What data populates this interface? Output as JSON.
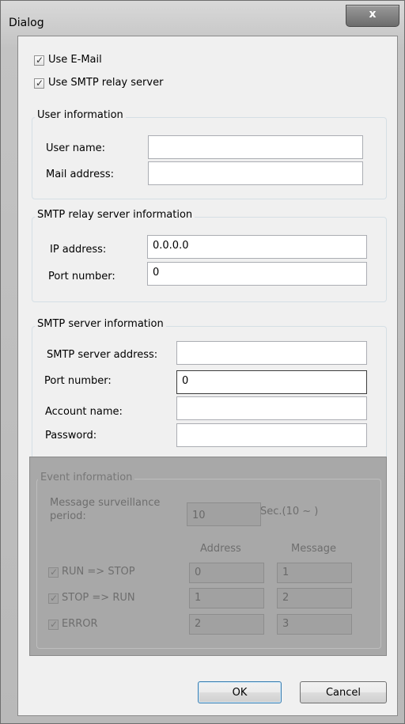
{
  "window": {
    "title": "Dialog",
    "close_glyph": "x"
  },
  "options": {
    "use_email": {
      "label": "Use E-Mail",
      "checked": true
    },
    "use_smtp_relay": {
      "label": "Use SMTP relay server",
      "checked": true
    }
  },
  "user_info": {
    "title": "User information",
    "user_name_label": "User name:",
    "user_name_value": "",
    "mail_address_label": "Mail address:",
    "mail_address_value": ""
  },
  "relay_info": {
    "title": "SMTP relay server information",
    "ip_label": "IP address:",
    "ip_value": "0.0.0.0",
    "port_label": "Port number:",
    "port_value": "0"
  },
  "smtp_info": {
    "title": "SMTP server information",
    "address_label": "SMTP server address:",
    "address_value": "",
    "port_label": "Port number:",
    "port_value": "0",
    "account_label": "Account name:",
    "account_value": "",
    "password_label": "Password:",
    "password_value": ""
  },
  "event_info": {
    "title": "Event information",
    "period_label_line1": "Message surveillance",
    "period_label_line2": "period:",
    "period_value": "10",
    "period_unit": "Sec.(10 ~ )",
    "address_header": "Address",
    "message_header": "Message",
    "rows": [
      {
        "label": "RUN => STOP",
        "address": "0",
        "message": "1",
        "checked": true
      },
      {
        "label": "STOP => RUN",
        "address": "1",
        "message": "2",
        "checked": true
      },
      {
        "label": "ERROR",
        "address": "2",
        "message": "3",
        "checked": true
      }
    ],
    "enabled": false
  },
  "buttons": {
    "ok": "OK",
    "cancel": "Cancel"
  },
  "icons": {
    "check": "✓"
  }
}
